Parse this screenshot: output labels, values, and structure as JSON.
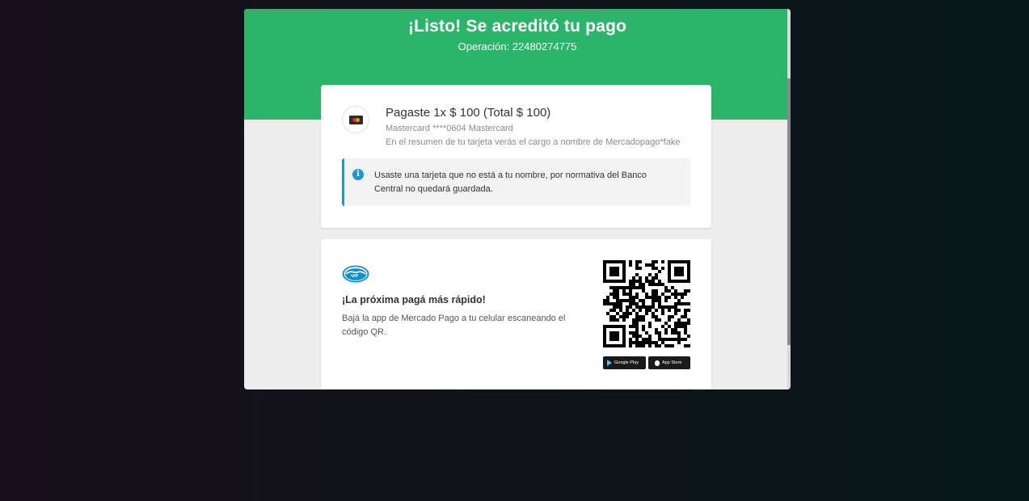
{
  "header": {
    "title": "¡Listo! Se acreditó tu pago",
    "operation": "Operación: 22480274775"
  },
  "payment": {
    "summary": "Pagaste 1x $ 100 (Total $ 100)",
    "card": "Mastercard ****0604 Mastercard",
    "statement": "En el resumen de tu tarjeta verás el cargo a nombre de Mercadopago*fake",
    "card_icon": "mastercard-icon"
  },
  "notice": {
    "icon": "info-icon",
    "text": "Usaste una tarjeta que no está a tu nombre, por normativa del Banco Central no quedará guardada."
  },
  "app_promo": {
    "logo": "mercado-pago-handshake-logo",
    "title": "¡La próxima pagá más rápido!",
    "description": "Bajá la app de Mercado Pago a tu celular escaneando el código QR.",
    "google_play_label": "Google Play",
    "app_store_label": "App Store"
  },
  "colors": {
    "header_green": "#2bb56a",
    "info_blue": "#1e96d2"
  }
}
